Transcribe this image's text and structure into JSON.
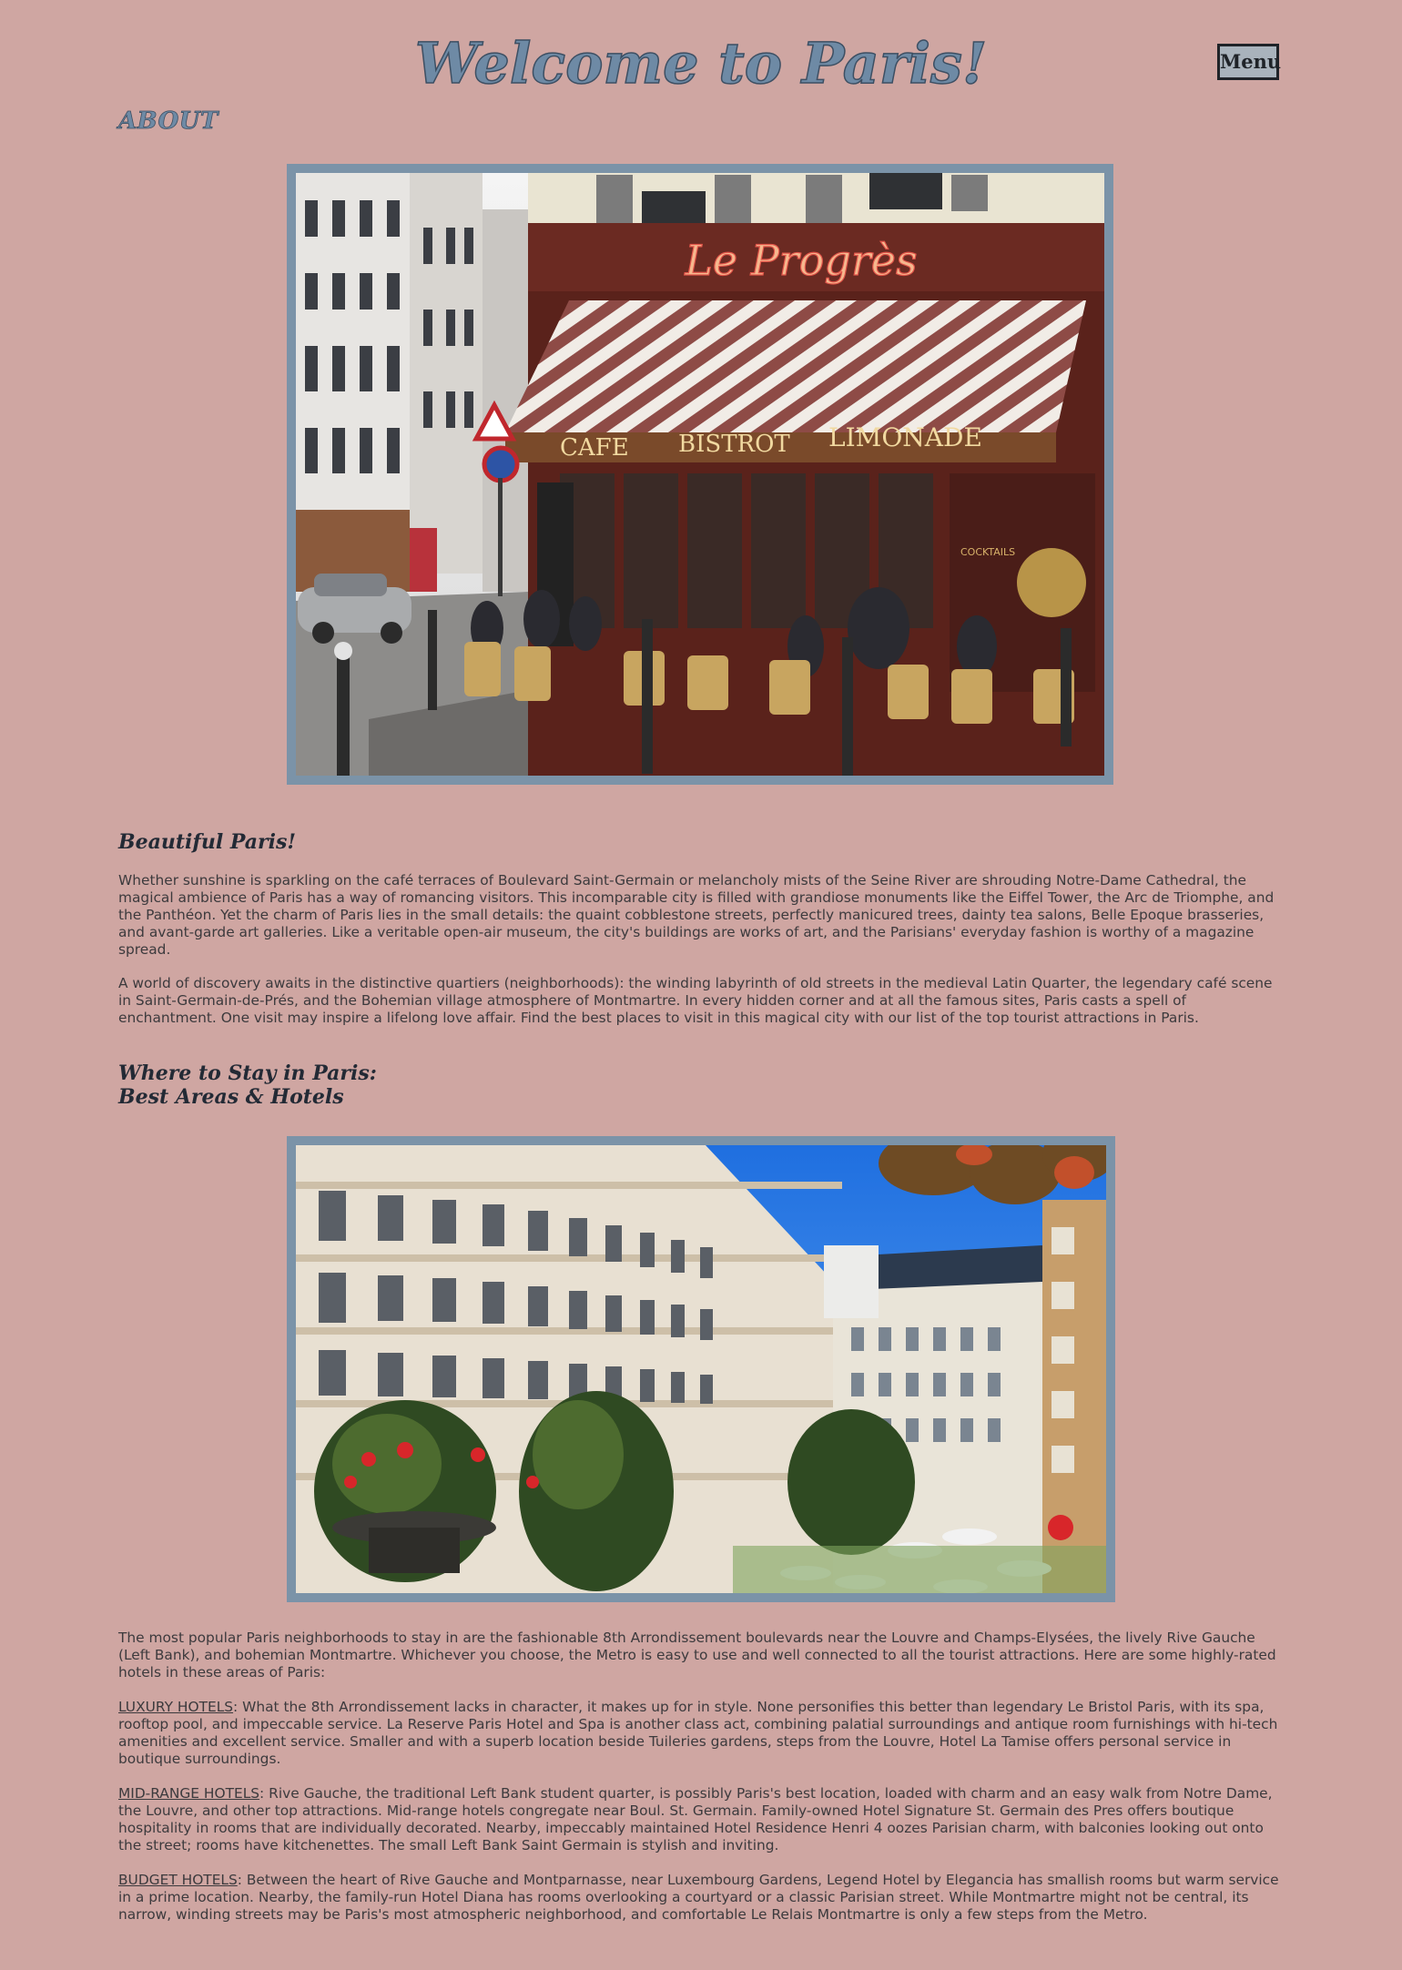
{
  "header": {
    "title": "Welcome to Paris!",
    "menu_label": "Menu",
    "about_label": "ABOUT"
  },
  "images": {
    "cafe": {
      "alt": "Le Progrès café",
      "sign": "Le Progrès",
      "awning": [
        "CAFE",
        "BISTROT",
        "LIMONADE"
      ],
      "cocktails": "COCKTAILS"
    },
    "hotel": {
      "alt": "Paris hotel courtyard"
    }
  },
  "sections": {
    "beautiful": {
      "heading": "Beautiful Paris!",
      "p1": "Whether sunshine is sparkling on the café terraces of Boulevard Saint-Germain or melancholy mists of the Seine River are shrouding Notre-Dame Cathedral, the magical ambience of Paris has a way of romancing visitors. This incomparable city is filled with grandiose monuments like the Eiffel Tower, the Arc de Triomphe, and the Panthéon. Yet the charm of Paris lies in the small details: the quaint cobblestone streets, perfectly manicured trees, dainty tea salons, Belle Epoque brasseries, and avant-garde art galleries. Like a veritable open-air museum, the city's buildings are works of art, and the Parisians' everyday fashion is worthy of a magazine spread.",
      "p2": "A world of discovery awaits in the distinctive quartiers (neighborhoods): the winding labyrinth of old streets in the medieval Latin Quarter, the legendary café scene in Saint-Germain-de-Prés, and the Bohemian village atmosphere of Montmartre. In every hidden corner and at all the famous sites, Paris casts a spell of enchantment. One visit may inspire a lifelong love affair. Find the best places to visit in this magical city with our list of the top tourist attractions in Paris."
    },
    "stay": {
      "heading_line1": "Where to Stay in Paris:",
      "heading_line2": "Best Areas & Hotels",
      "intro": "The most popular Paris neighborhoods to stay in are the fashionable 8th Arrondissement boulevards near the Louvre and Champs-Elysées, the lively Rive Gauche (Left Bank), and bohemian Montmartre. Whichever you choose, the Metro is easy to use and well connected to all the tourist attractions. Here are some highly-rated hotels in these areas of Paris:",
      "luxury_label": "LUXURY HOTELS",
      "luxury_text": ": What the 8th Arrondissement lacks in character, it makes up for in style. None personifies this better than legendary Le Bristol Paris, with its spa, rooftop pool, and impeccable service. La Reserve Paris Hotel and Spa is another class act, combining palatial surroundings and antique room furnishings with hi-tech amenities and excellent service. Smaller and with a superb location beside Tuileries gardens, steps from the Louvre, Hotel La Tamise offers personal service in boutique surroundings.",
      "midrange_label": "MID-RANGE HOTELS",
      "midrange_text": ": Rive Gauche, the traditional Left Bank student quarter, is possibly Paris's best location, loaded with charm and an easy walk from Notre Dame, the Louvre, and other top attractions. Mid-range hotels congregate near Boul. St. Germain. Family-owned Hotel Signature St. Germain des Pres offers boutique hospitality in rooms that are individually decorated. Nearby, impeccably maintained Hotel Residence Henri 4 oozes Parisian charm, with balconies looking out onto the street; rooms have kitchenettes. The small Left Bank Saint Germain is stylish and inviting.",
      "budget_label": "BUDGET HOTELS",
      "budget_text": ": Between the heart of Rive Gauche and Montparnasse, near Luxembourg Gardens, Legend Hotel by Elegancia has smallish rooms but warm service in a prime location. Nearby, the family-run Hotel Diana has rooms overlooking a courtyard or a classic Parisian street. While Montmartre might not be central, its narrow, winding streets may be Paris's most atmospheric neighborhood, and comfortable Le Relais Montmartre is only a few steps from the Metro."
    }
  },
  "colors": {
    "background": "#cfa6a2",
    "title": "#6e8aa5",
    "frame": "#7b93a8",
    "heading": "#232a35",
    "body_text": "#3c3a3d"
  }
}
